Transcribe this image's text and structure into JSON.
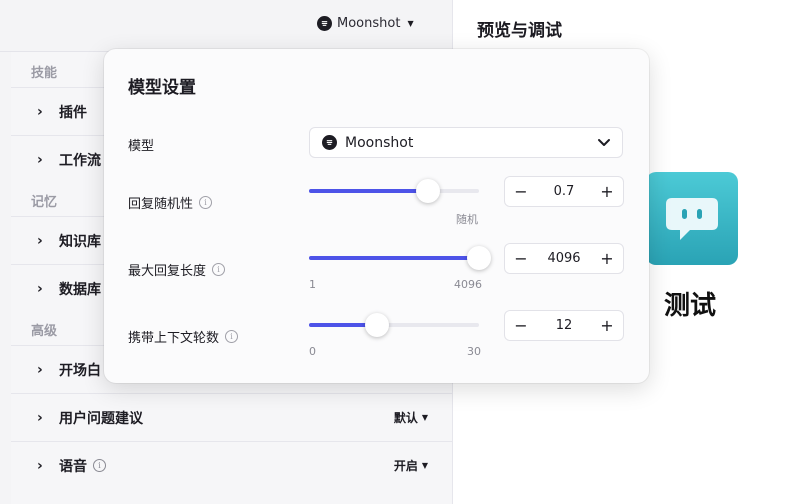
{
  "header": {
    "model_name": "Moonshot"
  },
  "left_panel": {
    "group_skills": "技能",
    "group_memory": "记忆",
    "group_advanced": "高级",
    "rows": {
      "plugins": "插件",
      "workflow": "工作流",
      "knowledge": "知识库",
      "database": "数据库",
      "opening": "开场白",
      "suggestions": "用户问题建议",
      "suggestions_value": "默认",
      "voice": "语音",
      "voice_value": "开启"
    }
  },
  "preview": {
    "title": "预览与调试",
    "bot_name": "测试",
    "avatar_color": "#3bb8c8"
  },
  "popover": {
    "title": "模型设置",
    "model_label": "模型",
    "model_value": "Moonshot",
    "temperature": {
      "label": "回复随机性",
      "value": "0.7",
      "level": 0.7,
      "tick_right": "随机"
    },
    "max_length": {
      "label": "最大回复长度",
      "value": "4096",
      "level": 1.0,
      "tick_left": "1",
      "tick_right": "4096"
    },
    "context_rounds": {
      "label": "携带上下文轮数",
      "value": "12",
      "level": 0.4,
      "tick_left": "0",
      "tick_right": "30"
    },
    "minus": "−",
    "plus": "+"
  },
  "colors": {
    "accent": "#4d53e8"
  }
}
